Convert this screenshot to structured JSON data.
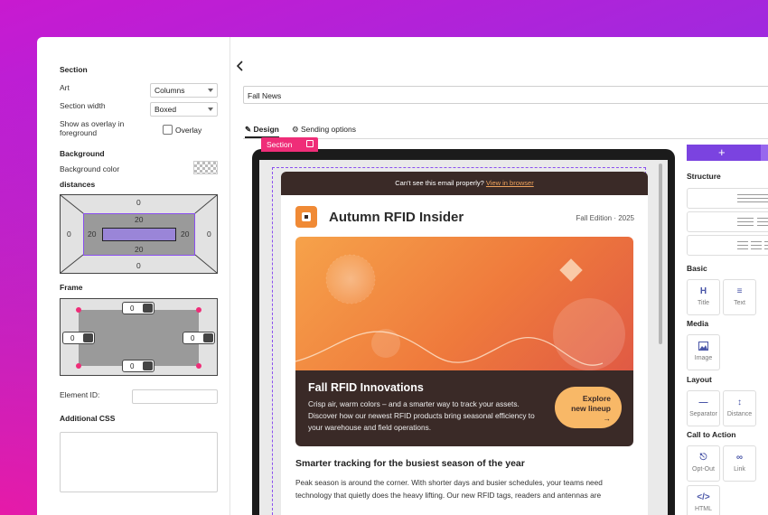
{
  "settings": {
    "section_heading": "Section",
    "art_label": "Art",
    "art_value": "Columns",
    "width_label": "Section width",
    "width_value": "Boxed",
    "overlay_label": "Show as overlay in foreground",
    "overlay_checkbox_label": "Overlay",
    "background_heading": "Background",
    "bg_color_label": "Background color",
    "distances_heading": "distances",
    "distances": {
      "outer_top": "0",
      "outer_left": "0",
      "outer_right": "0",
      "outer_bottom": "0",
      "inner_top": "20",
      "inner_left": "20",
      "inner_right": "20",
      "inner_bottom": "20"
    },
    "frame_heading": "Frame",
    "frame": {
      "top": "0",
      "left": "0",
      "right": "0",
      "bottom": "0"
    },
    "element_id_label": "Element ID:",
    "css_heading": "Additional CSS"
  },
  "editor": {
    "name_value": "Fall News",
    "tabs": [
      {
        "label": "Design"
      },
      {
        "label": "Sending options"
      }
    ],
    "section_tag": "Section"
  },
  "email": {
    "preheader_text": "Can't see this email properly?",
    "preheader_link": "View in browser",
    "brand": "Autumn RFID Insider",
    "edition": "Fall Edition · 2025",
    "hero_title": "Fall RFID Innovations",
    "hero_body": "Crisp air, warm colors – and a smarter way to track your assets. Discover how our newest RFID products bring seasonal efficiency to your warehouse and field operations.",
    "cta_line1": "Explore",
    "cta_line2": "new lineup",
    "cta_arrow": "→",
    "section_title": "Smarter tracking for the busiest season of the year",
    "section_body": "Peak season is around the corner. With shorter days and busier schedules, your teams need technology that quietly does the heavy lifting. Our new RFID tags, readers and antennas are"
  },
  "palette": {
    "add_label": "+",
    "structure_heading": "Structure",
    "basic_heading": "Basic",
    "basic_items": [
      {
        "label": "Title",
        "icon": "heading-icon"
      },
      {
        "label": "Text",
        "icon": "text-lines-icon"
      }
    ],
    "media_heading": "Media",
    "media_items": [
      {
        "label": "Image",
        "icon": "image-icon"
      }
    ],
    "layout_heading": "Layout",
    "layout_items": [
      {
        "label": "Separator",
        "icon": "separator-icon"
      },
      {
        "label": "Distance",
        "icon": "distance-icon"
      }
    ],
    "cta_heading": "Call to Action",
    "cta_items": [
      {
        "label": "Opt-Out",
        "icon": "opt-out-icon"
      },
      {
        "label": "Link",
        "icon": "link-icon"
      }
    ],
    "html_item": {
      "label": "HTML",
      "icon": "code-icon"
    }
  },
  "colors": {
    "accent": "#7b43e0",
    "section_tag": "#ef2d78",
    "brand_orange": "#f08a35",
    "email_dark": "#3a2a27"
  }
}
